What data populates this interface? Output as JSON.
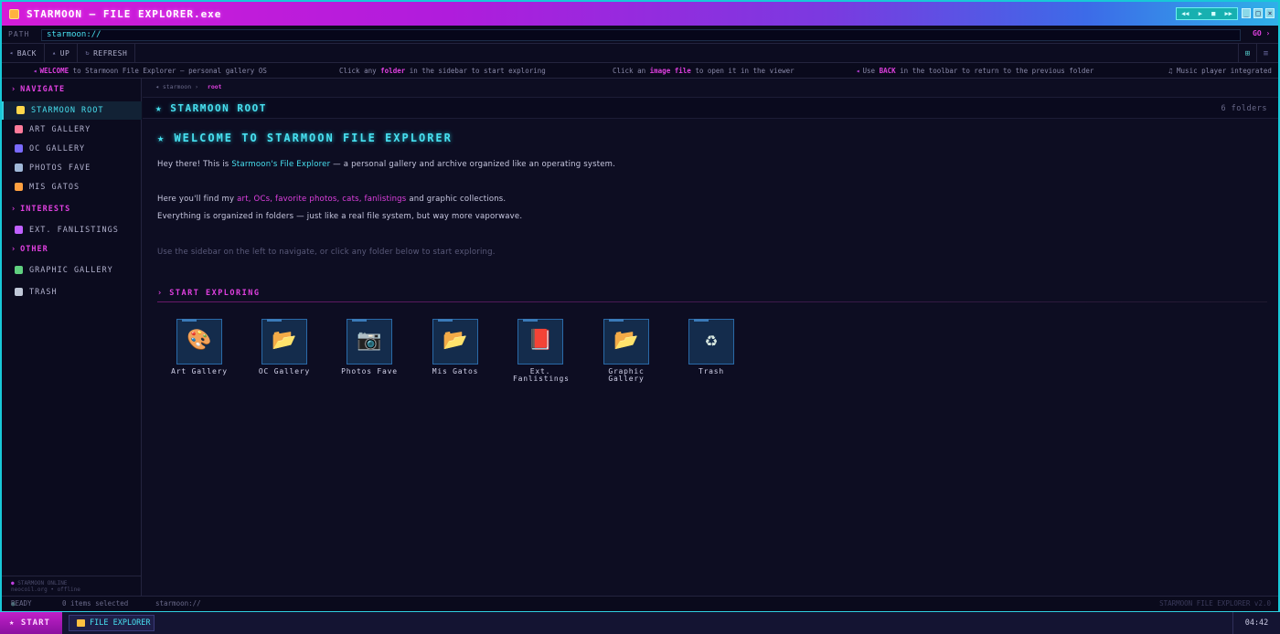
{
  "window": {
    "title": "STARMOON — FILE EXPLORER.exe"
  },
  "media": {
    "controls": [
      "◀◀",
      "▶",
      "■",
      "▶▶"
    ]
  },
  "pathbar": {
    "label": "PATH",
    "value": "starmoon://",
    "go_label": "GO"
  },
  "toolbar": {
    "back": "BACK",
    "up": "UP",
    "refresh": "REFRESH"
  },
  "ticker": {
    "messages": [
      {
        "hl": "WELCOME",
        "pre": "",
        "post": "to Starmoon File Explorer — personal gallery OS"
      },
      {
        "pre": "Click any",
        "hl": "folder",
        "post": "in the sidebar to start exploring"
      },
      {
        "pre": "Click an",
        "hl": "image file",
        "post": "to open it in the viewer"
      },
      {
        "pre": "Use",
        "hl": "BACK",
        "post": "in the toolbar to return to the previous folder"
      },
      {
        "pre": "♫ Music player integrated",
        "hl": "",
        "post": ""
      }
    ]
  },
  "sidebar": {
    "sections": [
      {
        "title": "NAVIGATE"
      },
      {
        "title": "INTERESTS"
      },
      {
        "title": "OTHER"
      }
    ],
    "items": [
      {
        "label": "STARMOON ROOT",
        "icon": "star-icon",
        "color": "#ffd84a"
      },
      {
        "label": "ART GALLERY",
        "icon": "palette-icon",
        "color": "#ff7a9a"
      },
      {
        "label": "OC GALLERY",
        "icon": "people-icon",
        "color": "#7a6aff"
      },
      {
        "label": "PHOTOS FAVE",
        "icon": "photo-icon",
        "color": "#a0b8d8"
      },
      {
        "label": "MIS GATOS",
        "icon": "cat-icon",
        "color": "#ffa040"
      },
      {
        "label": "EXT. FANLISTINGS",
        "icon": "heart-icon",
        "color": "#c060ff"
      },
      {
        "label": "GRAPHIC GALLERY",
        "icon": "image-icon",
        "color": "#60d080"
      },
      {
        "label": "TRASH",
        "icon": "trash-icon",
        "color": "#c0c8d8"
      }
    ],
    "footer_line1": "STARMOON ONLINE",
    "footer_line2": "neocoil.org • offline"
  },
  "main": {
    "breadcrumb_root": "starmoon",
    "breadcrumb_current": "root",
    "folder_title": "STARMOON ROOT",
    "folder_count": "6 folders",
    "welcome": "WELCOME TO STARMOON FILE EXPLORER",
    "p1_a": "Hey there! This is",
    "p1_link": "Starmoon's File Explorer",
    "p1_b": "— a personal gallery and archive organized like an operating system.",
    "p2_a": "Here you'll find my",
    "p2_links": "art, OCs, favorite photos, cats, fanlistings",
    "p2_b": "and graphic collections.",
    "p3": "Everything is organized in folders — just like a real file system, but way more vaporwave.",
    "p4": "Use the sidebar on the left to navigate, or click any folder below to start exploring.",
    "explore_title": "START EXPLORING",
    "tiles": [
      {
        "label": "Art Gallery",
        "glyph": "🎨",
        "icon": "art-icon"
      },
      {
        "label": "OC Gallery",
        "glyph": "📂",
        "icon": "folder-icon"
      },
      {
        "label": "Photos Fave",
        "glyph": "📷",
        "icon": "camera-icon"
      },
      {
        "label": "Mis Gatos",
        "glyph": "📂",
        "icon": "folder-icon"
      },
      {
        "label": "Ext. Fanlistings",
        "glyph": "📕",
        "icon": "book-icon"
      },
      {
        "label": "Graphic Gallery",
        "glyph": "📂",
        "icon": "folder-icon"
      },
      {
        "label": "Trash",
        "glyph": "♻",
        "icon": "recycle-icon"
      }
    ]
  },
  "status": {
    "ready": "READY",
    "selected": "0 items selected",
    "path": "starmoon://",
    "version": "STARMOON FILE EXPLORER v2.0"
  },
  "taskbar": {
    "start": "START",
    "task": "FILE EXPLORER",
    "clock": "04:42"
  },
  "colors": {
    "accent_cyan": "#48e0f0",
    "accent_magenta": "#e040e0",
    "background": "#0d0d22"
  }
}
